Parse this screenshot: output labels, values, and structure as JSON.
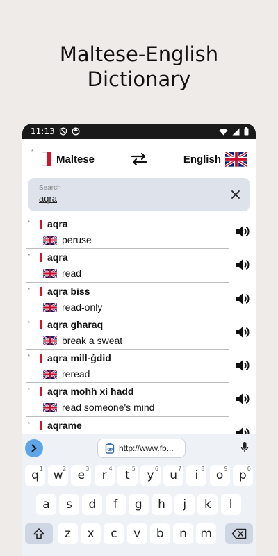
{
  "promo": {
    "line1": "Maltese-English",
    "line2": "Dictionary"
  },
  "status_bar": {
    "time": "11:13"
  },
  "lang_bar": {
    "source": "Maltese",
    "target": "English",
    "star": "*"
  },
  "search": {
    "placeholder": "Search",
    "value": "aqra"
  },
  "results": [
    {
      "word": "aqra",
      "translation": "peruse"
    },
    {
      "word": "aqra",
      "translation": "read"
    },
    {
      "word": "aqra biss",
      "translation": "read-only"
    },
    {
      "word": "aqra għaraq",
      "translation": "break a sweat"
    },
    {
      "word": "aqra mill-ġdid",
      "translation": "reread"
    },
    {
      "word": "aqra moħħ xi ħadd",
      "translation": "read someone's mind"
    },
    {
      "word": "aqrame",
      "translation": ""
    }
  ],
  "keyboard": {
    "suggestion": "http://www.fb...",
    "row1": [
      {
        "k": "q",
        "n": "1"
      },
      {
        "k": "w",
        "n": "2"
      },
      {
        "k": "e",
        "n": "3"
      },
      {
        "k": "r",
        "n": "4"
      },
      {
        "k": "t",
        "n": "5"
      },
      {
        "k": "y",
        "n": "6"
      },
      {
        "k": "u",
        "n": "7"
      },
      {
        "k": "i",
        "n": "8"
      },
      {
        "k": "o",
        "n": "9"
      },
      {
        "k": "p",
        "n": "0"
      }
    ],
    "row2": [
      "a",
      "s",
      "d",
      "f",
      "g",
      "h",
      "j",
      "k",
      "l"
    ],
    "row3": [
      "z",
      "x",
      "c",
      "v",
      "b",
      "n",
      "m"
    ]
  },
  "colors": {
    "malta_red": "#cf142b",
    "search_bg": "#dde2eb",
    "kb_accent": "#5ea5e8"
  }
}
